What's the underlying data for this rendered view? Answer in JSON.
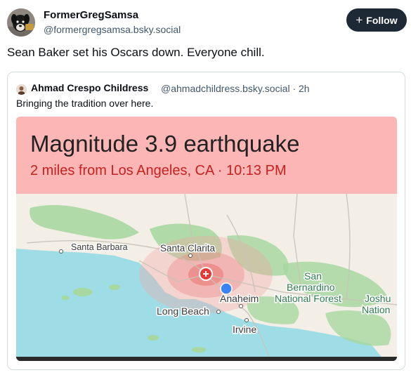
{
  "post": {
    "author": {
      "display_name": "FormerGregSamsa",
      "handle": "@formergregsamsa.bsky.social",
      "avatar_icon": "dog-avatar-icon"
    },
    "follow_button": {
      "label": "Follow",
      "icon": "plus-icon"
    },
    "text": "Sean Baker set his Oscars down. Everyone chill."
  },
  "quote": {
    "author": {
      "display_name": "Ahmad Crespo Childress",
      "meta": "@ahmadchildress.bsky.social · 2h"
    },
    "text": "Bringing the tradition over here.",
    "image": {
      "alert_title": "Magnitude 3.9 earthquake",
      "alert_subtitle": "2 miles from Los Angeles, CA · 10:13 PM",
      "map_labels": {
        "santa_barbara": "Santa Barbara",
        "santa_clarita": "Santa Clarita",
        "san": "San",
        "bernardino": "Bernardino",
        "national_forest": "National Forest",
        "anaheim": "Anaheim",
        "long_beach": "Long Beach",
        "irvine": "Irvine",
        "joshua": "Joshu",
        "nation": "Nation"
      },
      "colors": {
        "alert_background": "#fcb6b6",
        "alert_subtitle": "#c5221f",
        "ocean": "#9fdde6",
        "land": "#f3efe6",
        "forest": "#a8d7a0",
        "epicenter": "#e53935",
        "location_dot": "#3b82f6"
      }
    }
  }
}
